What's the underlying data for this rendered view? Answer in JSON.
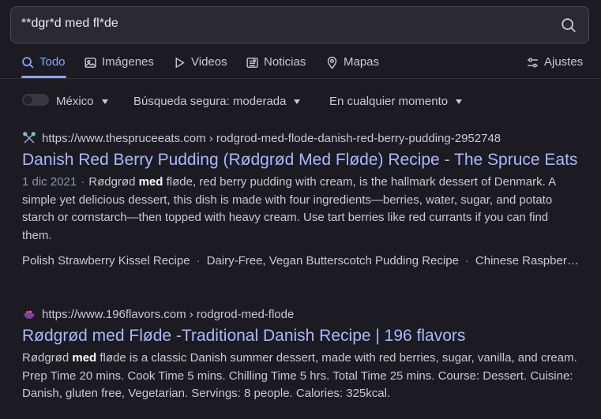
{
  "search": {
    "query": "**dgr*d med fl*de"
  },
  "tabs": [
    {
      "label": "Todo",
      "icon": "search-icon",
      "active": true
    },
    {
      "label": "Imágenes",
      "icon": "image-icon"
    },
    {
      "label": "Videos",
      "icon": "play-icon"
    },
    {
      "label": "Noticias",
      "icon": "newspaper-icon"
    },
    {
      "label": "Mapas",
      "icon": "map-pin-icon"
    }
  ],
  "settings_label": "Ajustes",
  "filters": {
    "region": "México",
    "safe_search": "Búsqueda segura: moderada",
    "time": "En cualquier momento"
  },
  "results": [
    {
      "url": "https://www.thespruceeats.com",
      "path": " › rodgrod-med-flode-danish-red-berry-pudding-2952748",
      "title": "Danish Red Berry Pudding (Rødgrød Med Fløde) Recipe - The Spruce Eats",
      "date": "1 dic 2021",
      "snippet_pre": "Rødgrød ",
      "snippet_bold": "med",
      "snippet_post": " fløde, red berry pudding with cream, is the hallmark dessert of Denmark. A simple yet delicious dessert, this dish is made with four ingredients—berries, water, sugar, and potato starch or cornstarch—then topped with heavy cream. Use tart berries like red currants if you can find them.",
      "related": [
        "Polish Strawberry Kissel Recipe",
        "Dairy-Free, Vegan Butterscotch Pudding Recipe",
        "Chinese Raspberry Pudding"
      ]
    },
    {
      "url": "https://www.196flavors.com",
      "path": " › rodgrod-med-flode",
      "title": "Rødgrød med Fløde -Traditional Danish Recipe | 196 flavors",
      "snippet_pre": "Rødgrød ",
      "snippet_bold": "med",
      "snippet_post": " fløde is a classic Danish summer dessert, made with red berries, sugar, vanilla, and cream. Prep Time 20 mins. Cook Time 5 mins. Chilling Time 5 hrs. Total Time 25 mins. Course: Dessert. Cuisine: Danish, gluten free, Vegetarian. Servings: 8 people. Calories: 325kcal."
    }
  ],
  "colors": {
    "accent": "#8aa6ff",
    "title": "#a8b8ff",
    "background": "#1c1b22"
  }
}
